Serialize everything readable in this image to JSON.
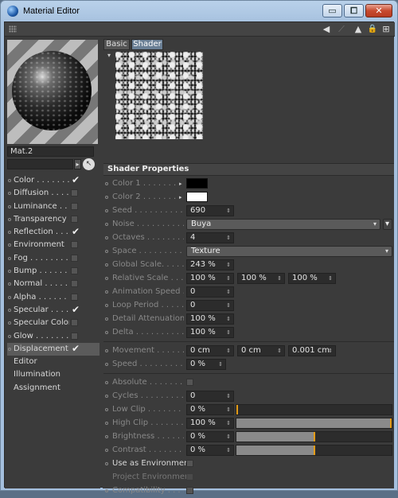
{
  "window": {
    "title": "Material Editor",
    "caption_buttons": {
      "minimize": "▭",
      "maximize": "⧠",
      "close": "✕"
    }
  },
  "toolbar": {
    "icons": [
      "grip-icon",
      "arrow-left-icon",
      "arrow-up-icon",
      "lock-icon",
      "new-window-icon"
    ],
    "glyphs": {
      "back": "◀",
      "up": "▲",
      "lock": "🔒",
      "new": "⊞"
    }
  },
  "material": {
    "name": "Mat.2",
    "name_field": "",
    "arrow": "▸",
    "pick_glyph": "↖"
  },
  "channels": [
    {
      "label": "Color",
      "dots": "Color . . . . . . . .",
      "checked": true,
      "has_box": true
    },
    {
      "label": "Diffusion",
      "dots": "Diffusion . . . . .",
      "checked": false,
      "has_box": true
    },
    {
      "label": "Luminance",
      "dots": "Luminance . . . .",
      "checked": false,
      "has_box": true
    },
    {
      "label": "Transparency",
      "dots": "Transparency",
      "checked": false,
      "has_box": true
    },
    {
      "label": "Reflection",
      "dots": "Reflection . . . .",
      "checked": true,
      "has_box": true
    },
    {
      "label": "Environment",
      "dots": "Environment",
      "checked": false,
      "has_box": true
    },
    {
      "label": "Fog",
      "dots": "Fog . . . . . . . . .",
      "checked": false,
      "has_box": true
    },
    {
      "label": "Bump",
      "dots": "Bump . . . . . . . .",
      "checked": false,
      "has_box": true
    },
    {
      "label": "Normal",
      "dots": "Normal . . . . . . .",
      "checked": false,
      "has_box": true
    },
    {
      "label": "Alpha",
      "dots": "Alpha . . . . . . . .",
      "checked": false,
      "has_box": true
    },
    {
      "label": "Specular",
      "dots": "Specular . . . . .",
      "checked": true,
      "has_box": true
    },
    {
      "label": "Specular Color",
      "dots": "Specular Color",
      "checked": false,
      "has_box": true
    },
    {
      "label": "Glow",
      "dots": "Glow . . . . . . . .",
      "checked": false,
      "has_box": true
    },
    {
      "label": "Displacement",
      "dots": "Displacement",
      "checked": true,
      "has_box": true
    },
    {
      "label": "Editor",
      "dots": "Editor . . . . . . .",
      "checked": false,
      "has_box": false
    },
    {
      "label": "Illumination",
      "dots": "Illumination",
      "checked": false,
      "has_box": false
    },
    {
      "label": "Assignment",
      "dots": "Assignment",
      "checked": false,
      "has_box": false
    }
  ],
  "check_glyph": "✔",
  "tabs": {
    "basic": "Basic",
    "shader": "Shader"
  },
  "shader_preview_arrow": "▾",
  "section_title": "Shader Properties",
  "params": {
    "color1": {
      "label": "Color 1 . . . . . . . .",
      "color": "#000000"
    },
    "color2": {
      "label": "Color 2 . . . . . . . .",
      "color": "#ffffff"
    },
    "seed": {
      "label": "Seed . . . . . . . . . . . .",
      "value": "690"
    },
    "noise": {
      "label": "Noise . . . . . . . . . . .",
      "value": "Buya"
    },
    "octaves": {
      "label": "Octaves . . . . . . . . .",
      "value": "4"
    },
    "space": {
      "label": "Space . . . . . . . . . . .",
      "value": "Texture"
    },
    "global_scale": {
      "label": "Global Scale. . . . . .",
      "value": "243 %"
    },
    "relative_scale": {
      "label": "Relative Scale . . . .",
      "values": [
        "100 %",
        "100 %",
        "100 %"
      ]
    },
    "animation_speed": {
      "label": "Animation Speed . . .",
      "value": "0"
    },
    "loop_period": {
      "label": "Loop Period . . . . . . .",
      "value": "0"
    },
    "detail_attenuation": {
      "label": "Detail Attenuation. . .",
      "value": "100 %"
    },
    "delta": {
      "label": "Delta . . . . . . . . . . . .",
      "value": "100 %"
    },
    "movement": {
      "label": "Movement . . . . . . . .",
      "values": [
        "0 cm",
        "0 cm",
        "0.001 cm"
      ]
    },
    "speed": {
      "label": "Speed . . . . . . . . . . . .",
      "value": "0 %"
    },
    "absolute": {
      "label": "Absolute . . . . . . . . .",
      "checked": false
    },
    "cycles": {
      "label": "Cycles . . . . . . . . . . .",
      "value": "0"
    },
    "low_clip": {
      "label": "Low Clip . . . . . . . . .",
      "value": "0 %",
      "level": 0
    },
    "high_clip": {
      "label": "High Clip . . . . . . . . .",
      "value": "100 %",
      "level": 1
    },
    "brightness": {
      "label": "Brightness . . . . . . .",
      "value": "0 %",
      "level": 0.5
    },
    "contrast": {
      "label": "Contrast . . . . . . . . .",
      "value": "0 %",
      "level": 0.5
    },
    "use_as_environment": {
      "label": "Use as Environment",
      "checked": false
    },
    "project_environment": {
      "label": "Project Environment",
      "checked": false
    },
    "compatibility": {
      "label": "Compatibility . . . . . .",
      "checked": false
    }
  },
  "spin_glyph": "⇕",
  "dropdown_glyph": "▾",
  "swatch_glyph": "▸"
}
